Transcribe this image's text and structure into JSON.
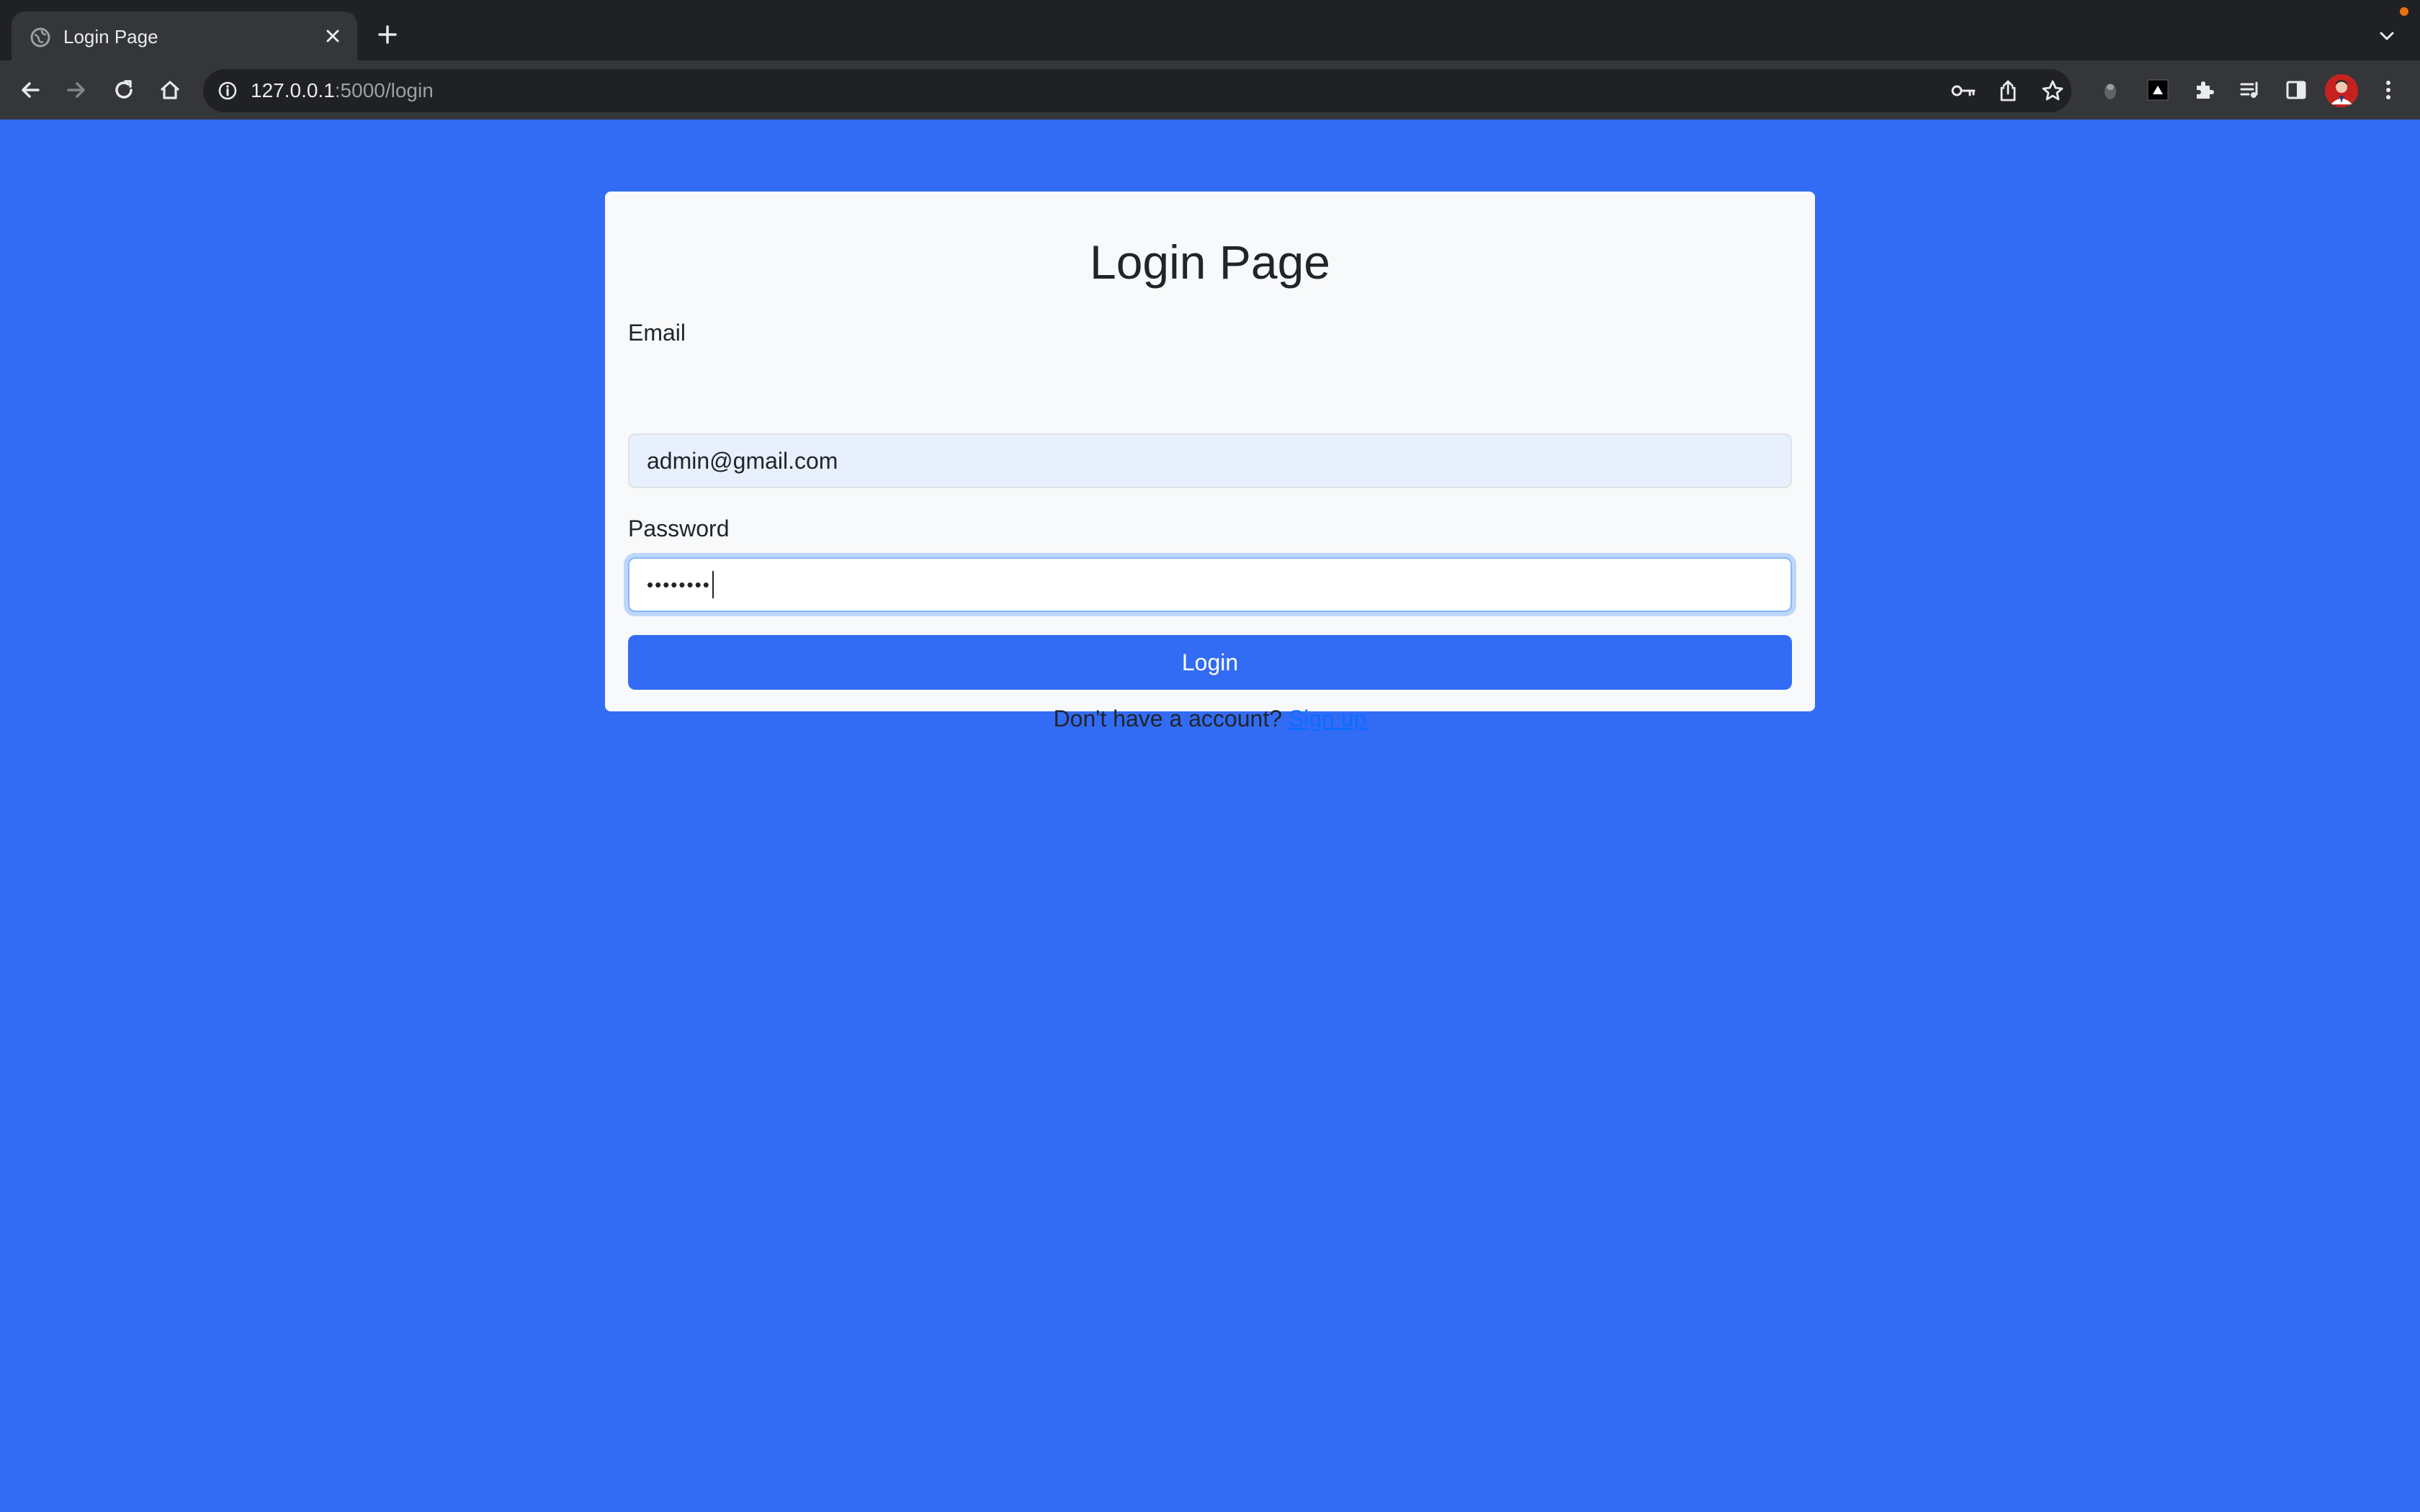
{
  "browser": {
    "tab": {
      "title": "Login Page",
      "favicon": "globe-icon"
    },
    "address": {
      "host": "127.0.0.1",
      "path": ":5000/login"
    },
    "icons": {
      "back": "arrow-left-icon",
      "forward": "arrow-right-icon",
      "reload": "reload-icon",
      "home": "home-icon",
      "password": "key-icon",
      "share": "share-icon",
      "bookmark": "star-icon",
      "extensions": "puzzle-icon",
      "media": "media-queue-icon",
      "sidepanel": "side-panel-icon",
      "menu": "kebab-menu-icon"
    },
    "colors": {
      "frame": "#202124",
      "toolbar": "#35363a",
      "accent": "#e8710a"
    }
  },
  "page": {
    "background": "#326cf5",
    "title": "Login Page",
    "form": {
      "email_label": "Email",
      "email_value": "admin@gmail.com",
      "password_label": "Password",
      "password_value": "••••••••",
      "login_button": "Login",
      "signup_prompt": "Don't have a account?",
      "signup_link": "Sign up"
    },
    "colors": {
      "card": "#f8f9fa",
      "button": "#326cf5",
      "link": "#0d6efd",
      "autofill": "#e8f0fe"
    }
  }
}
